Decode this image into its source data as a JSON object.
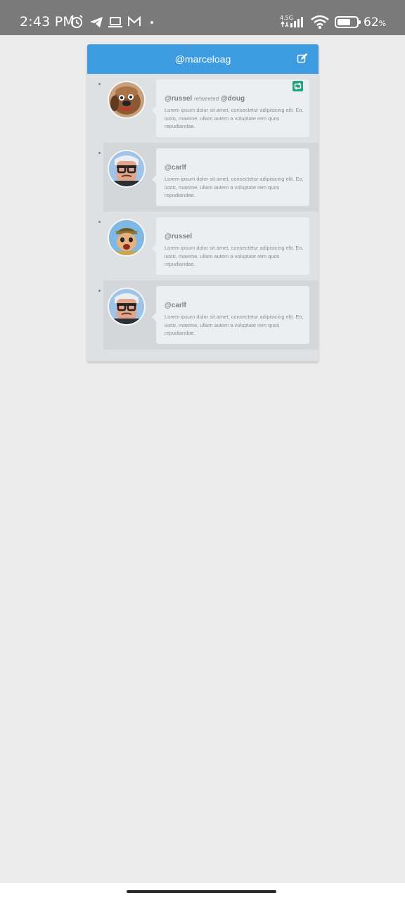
{
  "status_bar": {
    "time": "2:43 PM",
    "network_label": "4.5G",
    "battery": "62",
    "battery_unit": "%"
  },
  "panel": {
    "title": "@marceloag"
  },
  "tweets": [
    {
      "user": "@russel",
      "retweet_label": "retweeted",
      "original_user": "@doug",
      "text": "Lorem ipsum dolor sit amet, consectetur adipisicing elit. Eo, iusto, maxime, ullam autem a voluptate rem quos repudiandae.",
      "avatar": "dug-dog-avatar",
      "is_retweet": true
    },
    {
      "user": "@carlf",
      "text": "Lorem ipsum dolor sit amet, consectetur adipisicing elit. Eo, iusto, maxime, ullam autem a voluptate rem quos repudiandae.",
      "avatar": "carl-avatar",
      "is_retweet": false
    },
    {
      "user": "@russel",
      "text": "Lorem ipsum dolor sit amet, consectetur adipisicing elit. Eo, iusto, maxime, ullam autem a voluptate rem quos repudiandae.",
      "avatar": "russell-avatar",
      "is_retweet": false
    },
    {
      "user": "@carlf",
      "text": "Lorem ipsum dolor sit amet, consectetur adipisicing elit. Eo, iusto, maxime, ullam autem a voluptate rem quos repudiandae.",
      "avatar": "carl-avatar",
      "is_retweet": false
    }
  ],
  "colors": {
    "header": "#3d9be0",
    "retweet_badge": "#1fa67a",
    "panel_bg": "#dde1e3",
    "bubble_bg": "#eceff0"
  }
}
